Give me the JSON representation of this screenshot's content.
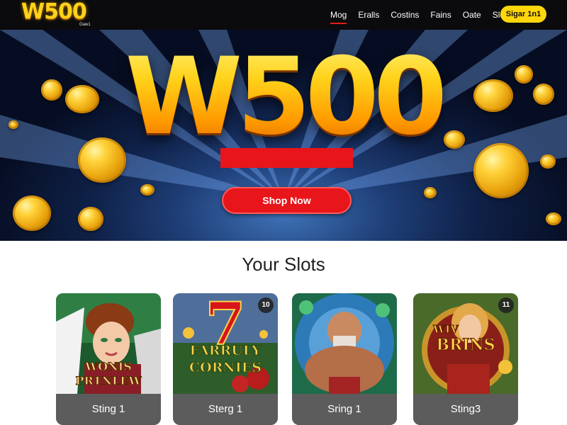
{
  "header": {
    "logo_text": "W500",
    "logo_sub": "Gaw1",
    "nav": [
      "Mog",
      "Eralls",
      "Costins",
      "Fains",
      "Oate",
      "Slot"
    ],
    "signin_label": "Sigar 1n1"
  },
  "hero": {
    "title": "W500",
    "cta_label": "Shop Now"
  },
  "section": {
    "title": "Your Slots"
  },
  "slots": [
    {
      "label": "Sting 1",
      "badge": "",
      "art_line1": "WONIS",
      "art_line2": "PRTNLEW"
    },
    {
      "label": "Sterg 1",
      "badge": "10",
      "art_line1": "FARRULY",
      "art_line2": "CORNIES",
      "art_symbol": "7"
    },
    {
      "label": "Sring 1",
      "badge": "",
      "art_line1": "",
      "art_line2": ""
    },
    {
      "label": "Sting3",
      "badge": "11",
      "art_line1": "WIV",
      "art_line2": "BRINS"
    }
  ],
  "colors": {
    "topbar_bg": "#0b0b0d",
    "accent_yellow": "#ffd60a",
    "cta_red": "#e8151b",
    "card_footer": "#5c5c5c"
  }
}
